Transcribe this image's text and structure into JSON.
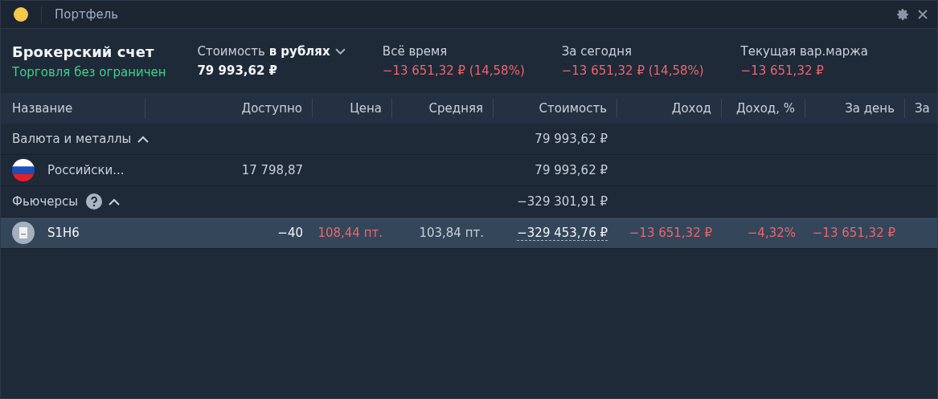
{
  "window": {
    "title": "Портфель"
  },
  "account": {
    "name": "Брокерский счет",
    "status": "Торговля без ограничен"
  },
  "stats": [
    {
      "kind": "selector",
      "label": "Стоимость **в рублях**",
      "value": "79 993,62 ₽",
      "negative": false
    },
    {
      "kind": "metric",
      "label": "Всё время",
      "value": "−13 651,32 ₽ (14,58%)",
      "negative": true
    },
    {
      "kind": "metric",
      "label": "За сегодня",
      "value": "−13 651,32 ₽ (14,58%)",
      "negative": true
    },
    {
      "kind": "metric",
      "label": "Текущая вар.маржа",
      "value": "−13 651,32 ₽",
      "negative": true
    }
  ],
  "table": {
    "columns": [
      "Название",
      "Доступно",
      "Цена",
      "Средняя",
      "Стоимость",
      "Доход",
      "Доход, %",
      "За день",
      "За"
    ],
    "rows": [
      {
        "kind": "group",
        "name": "Валюта и металлы",
        "help": false,
        "expanded": true,
        "cost": "79 993,62 ₽"
      },
      {
        "kind": "currency",
        "name": "Российски...",
        "selected": false,
        "cells": {
          "available": {
            "text": "17 798,87",
            "negative": false,
            "bright": false,
            "dotted": false
          },
          "cost": {
            "text": "79 993,62 ₽",
            "negative": false,
            "bright": false,
            "dotted": false
          }
        }
      },
      {
        "kind": "group",
        "name": "Фьючерсы",
        "help": true,
        "expanded": true,
        "cost": "−329 301,91 ₽"
      },
      {
        "kind": "future",
        "name": "S1H6",
        "selected": true,
        "cells": {
          "available": {
            "text": "−40",
            "negative": false,
            "bright": true,
            "dotted": false
          },
          "price": {
            "text": "108,44 пт.",
            "negative": true,
            "bright": false,
            "dotted": false
          },
          "average": {
            "text": "103,84 пт.",
            "negative": false,
            "bright": false,
            "dotted": false
          },
          "cost": {
            "text": "−329 453,76 ₽",
            "negative": false,
            "bright": true,
            "dotted": true
          },
          "income": {
            "text": "−13 651,32 ₽",
            "negative": true,
            "bright": false,
            "dotted": false
          },
          "income_pct": {
            "text": "−4,32%",
            "negative": true,
            "bright": false,
            "dotted": false
          },
          "day": {
            "text": "−13 651,32 ₽",
            "negative": true,
            "bright": false,
            "dotted": false
          }
        }
      }
    ]
  }
}
